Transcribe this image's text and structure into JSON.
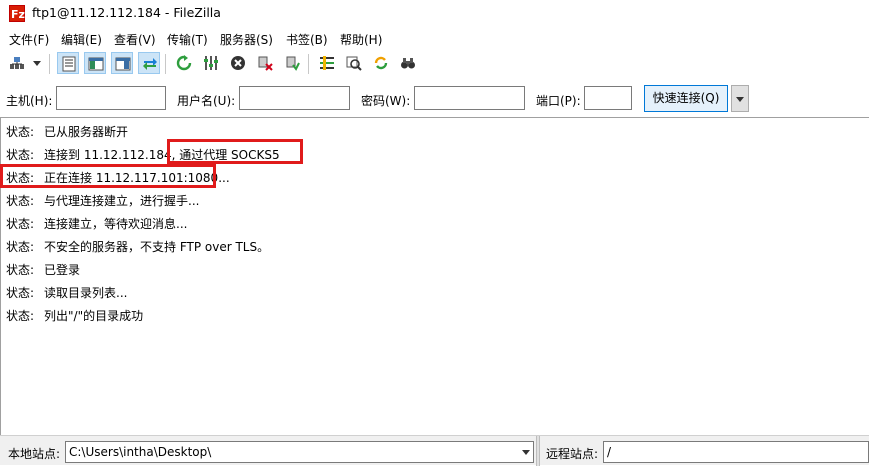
{
  "window": {
    "title": "ftp1@11.12.112.184 - FileZilla"
  },
  "menu": [
    {
      "label": "文件(F)"
    },
    {
      "label": "编辑(E)"
    },
    {
      "label": "查看(V)"
    },
    {
      "label": "传输(T)"
    },
    {
      "label": "服务器(S)"
    },
    {
      "label": "书签(B)"
    },
    {
      "label": "帮助(H)"
    }
  ],
  "toolbar": {
    "icons": [
      "site-manager-icon",
      "dropdown-arrow-icon",
      "toggle-message-log-icon",
      "toggle-local-tree-icon",
      "toggle-remote-tree-icon",
      "toggle-transfer-queue-icon",
      "refresh-icon",
      "process-queue-icon",
      "cancel-operation-icon",
      "disconnect-icon",
      "reconnect-icon",
      "directory-filters-icon",
      "compare-directories-icon",
      "sync-browsing-icon",
      "search-files-icon"
    ]
  },
  "quickconnect": {
    "host_label": "主机(H):",
    "user_label": "用户名(U):",
    "pass_label": "密码(W):",
    "port_label": "端口(P):",
    "host_value": "",
    "user_value": "",
    "pass_value": "",
    "port_value": "",
    "button_label": "快速连接(Q)"
  },
  "log": [
    {
      "status": "状态:",
      "message": "已从服务器断开"
    },
    {
      "status": "状态:",
      "message": "连接到 11.12.112.184, 通过代理 SOCKS5"
    },
    {
      "status": "状态:",
      "message": "正在连接 11.12.117.101:1080..."
    },
    {
      "status": "状态:",
      "message": "与代理连接建立，进行握手..."
    },
    {
      "status": "状态:",
      "message": "连接建立，等待欢迎消息..."
    },
    {
      "status": "状态:",
      "message": "不安全的服务器，不支持 FTP over TLS。"
    },
    {
      "status": "状态:",
      "message": "已登录"
    },
    {
      "status": "状态:",
      "message": "读取目录列表..."
    },
    {
      "status": "状态:",
      "message": "列出\"/\"的目录成功"
    }
  ],
  "local_site": {
    "label": "本地站点:",
    "path": "C:\\Users\\intha\\Desktop\\"
  },
  "remote_site": {
    "label": "远程站点:",
    "path": "/"
  },
  "colors": {
    "highlight": "#e01b1b",
    "accent": "#0078d7"
  }
}
